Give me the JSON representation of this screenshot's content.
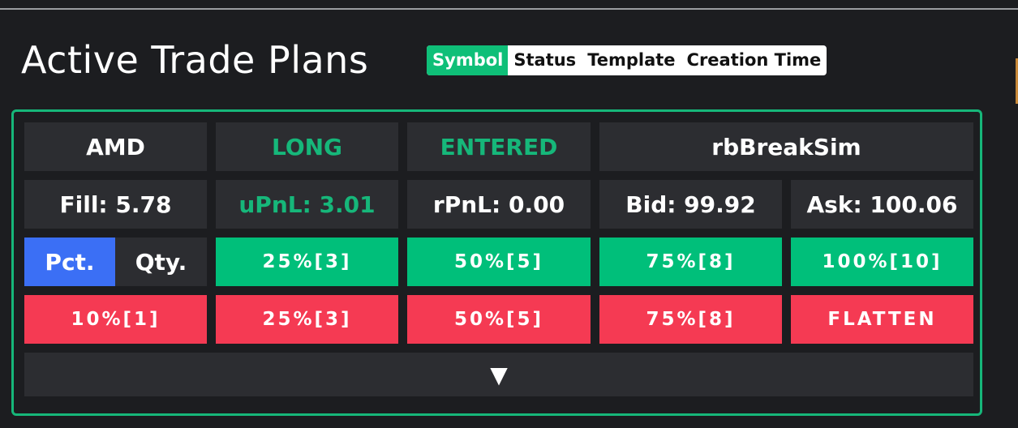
{
  "page": {
    "title": "Active Trade Plans"
  },
  "sort_options": [
    {
      "label": "Symbol",
      "active": true
    },
    {
      "label": "Status",
      "active": false
    },
    {
      "label": "Template",
      "active": false
    },
    {
      "label": "Creation Time",
      "active": false
    }
  ],
  "plan": {
    "symbol": "AMD",
    "side": "LONG",
    "status": "ENTERED",
    "template": "rbBreakSim",
    "fill": "Fill: 5.78",
    "upnl": "uPnL: 3.01",
    "rpnl": "rPnL: 0.00",
    "bid": "Bid: 99.92",
    "ask": "Ask: 100.06",
    "mode_toggle": {
      "pct": "Pct.",
      "qty": "Qty.",
      "selected": "Pct."
    },
    "add_buttons": [
      "25%[3]",
      "50%[5]",
      "75%[8]",
      "100%[10]"
    ],
    "reduce_buttons": [
      "10%[1]",
      "25%[3]",
      "50%[5]",
      "75%[8]",
      "FLATTEN"
    ],
    "expand_icon": "▼"
  },
  "colors": {
    "accent_green": "#00bf7a",
    "danger_red": "#f53a53",
    "toggle_blue": "#3b6ff5",
    "cell_dark": "#2c2d31",
    "background": "#1c1d20"
  }
}
